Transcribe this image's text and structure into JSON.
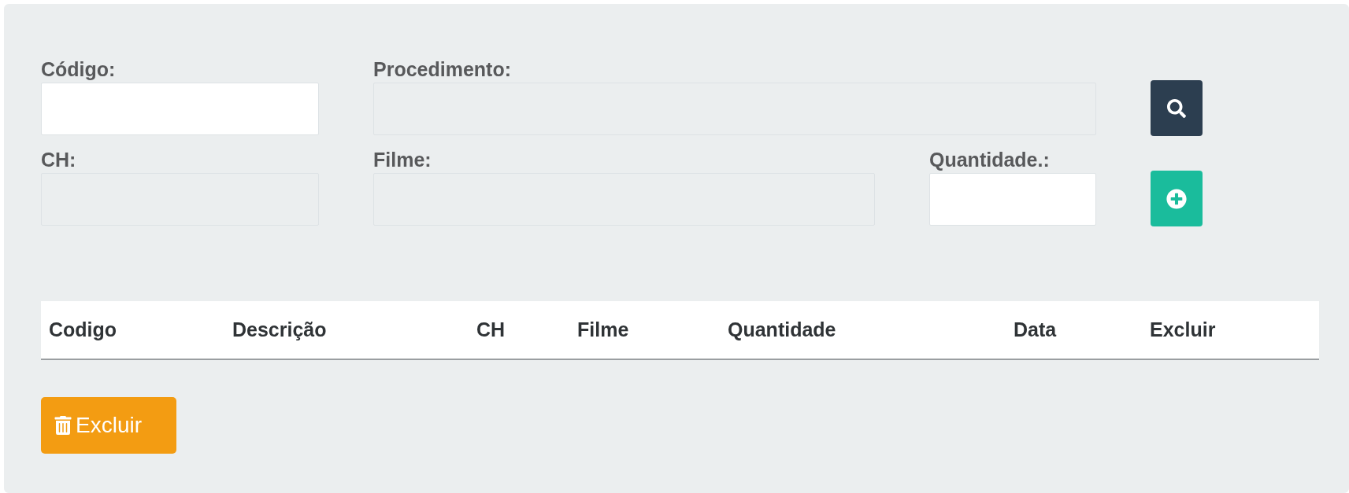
{
  "form": {
    "rows": [
      {
        "fields": [
          {
            "label": "Código:",
            "disabled": false
          },
          {
            "label": "Procedimento:",
            "disabled": true
          }
        ],
        "action": {
          "kind": "search"
        }
      },
      {
        "fields": [
          {
            "label": "CH:",
            "disabled": true
          },
          {
            "label": "Filme:",
            "disabled": true
          },
          {
            "label": "Quantidade.:",
            "disabled": false
          }
        ],
        "action": {
          "kind": "add"
        }
      }
    ]
  },
  "table": {
    "columns": [
      "Codigo",
      "Descrição",
      "CH",
      "Filme",
      "Quantidade",
      "Data",
      "Excluir"
    ]
  },
  "delete_button": {
    "label": "Excluir"
  }
}
